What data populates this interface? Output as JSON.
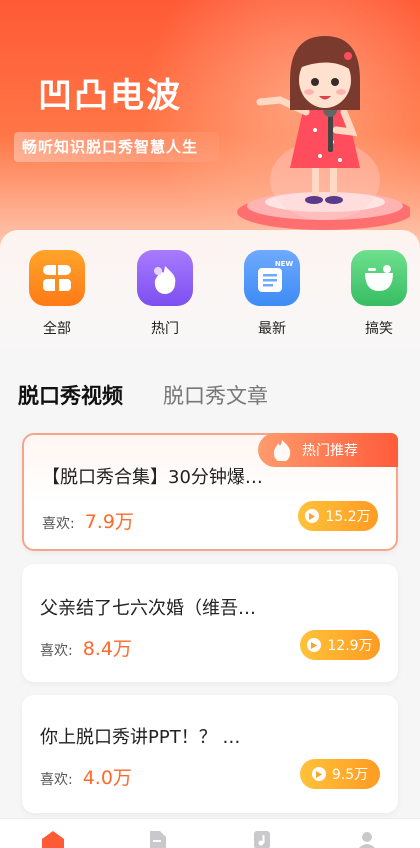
{
  "brand": {
    "title": "凹凸电波",
    "slogan": "畅听知识脱口秀智慧人生"
  },
  "categories": [
    {
      "label": "全部",
      "icon": "grid-icon",
      "color": "#ff8a1e"
    },
    {
      "label": "热门",
      "icon": "fire-icon",
      "color": "#8a5cf0"
    },
    {
      "label": "最新",
      "icon": "new-icon",
      "color": "#3d8bf5",
      "badge": "NEW"
    },
    {
      "label": "搞笑",
      "icon": "smile-icon",
      "color": "#3ec46d"
    }
  ],
  "tabs": [
    {
      "label": "脱口秀视频",
      "active": true
    },
    {
      "label": "脱口秀文章",
      "active": false
    }
  ],
  "hot_badge": "热门推荐",
  "likes_label": "喜欢:",
  "videos": [
    {
      "title": "【脱口秀合集】30分钟爆…",
      "likes": "7.9万",
      "plays": "15.2万",
      "featured": true
    },
    {
      "title": "父亲结了七六次婚（维吾…",
      "likes": "8.4万",
      "plays": "12.9万",
      "featured": false
    },
    {
      "title": "你上脱口秀讲PPT！？ …",
      "likes": "4.0万",
      "plays": "9.5万",
      "featured": false
    }
  ],
  "bottom_nav": [
    {
      "name": "home-icon",
      "active": true
    },
    {
      "name": "article-icon",
      "active": false
    },
    {
      "name": "music-icon",
      "active": false
    },
    {
      "name": "profile-icon",
      "active": false
    }
  ],
  "colors": {
    "accent": "#ff5a36",
    "likes": "#ff6a2a",
    "play": "#ffb02e"
  }
}
